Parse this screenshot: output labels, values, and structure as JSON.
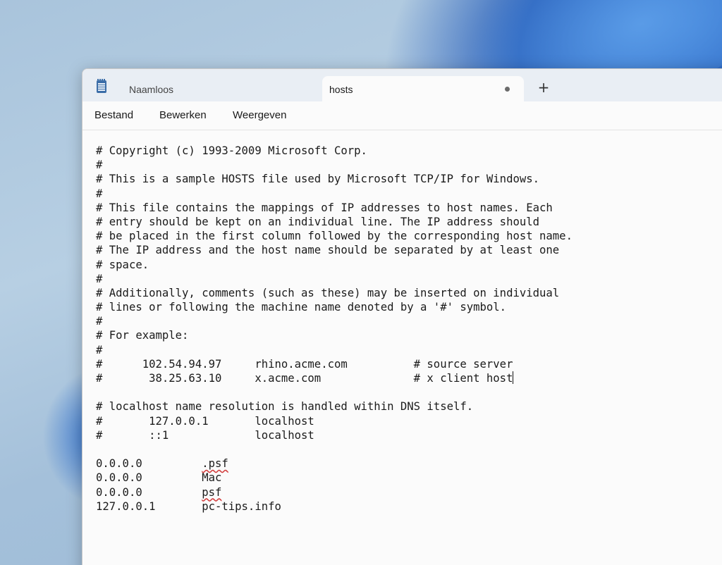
{
  "tabs": [
    {
      "label": "Naamloos",
      "active": false
    },
    {
      "label": "hosts",
      "active": true,
      "unsaved": true
    }
  ],
  "new_tab_symbol": "+",
  "menu": [
    "Bestand",
    "Bewerken",
    "Weergeven"
  ],
  "editor": {
    "lines": [
      "# Copyright (c) 1993-2009 Microsoft Corp.",
      "#",
      "# This is a sample HOSTS file used by Microsoft TCP/IP for Windows.",
      "#",
      "# This file contains the mappings of IP addresses to host names. Each",
      "# entry should be kept on an individual line. The IP address should",
      "# be placed in the first column followed by the corresponding host name.",
      "# The IP address and the host name should be separated by at least one",
      "# space.",
      "#",
      "# Additionally, comments (such as these) may be inserted on individual",
      "# lines or following the machine name denoted by a '#' symbol.",
      "#",
      "# For example:",
      "#",
      "#      102.54.94.97     rhino.acme.com          # source server",
      "#       38.25.63.10     x.acme.com              # x client host",
      "",
      "# localhost name resolution is handled within DNS itself.",
      "#       127.0.0.1       localhost",
      "#       ::1             localhost",
      "",
      "0.0.0.0         .psf",
      "0.0.0.0         Mac",
      "0.0.0.0         psf",
      "127.0.0.1       pc-tips.info"
    ],
    "spellcheck_flags": [
      {
        "line": 22,
        "word": ".psf"
      },
      {
        "line": 24,
        "word": "psf"
      }
    ],
    "caret_line": 16
  }
}
